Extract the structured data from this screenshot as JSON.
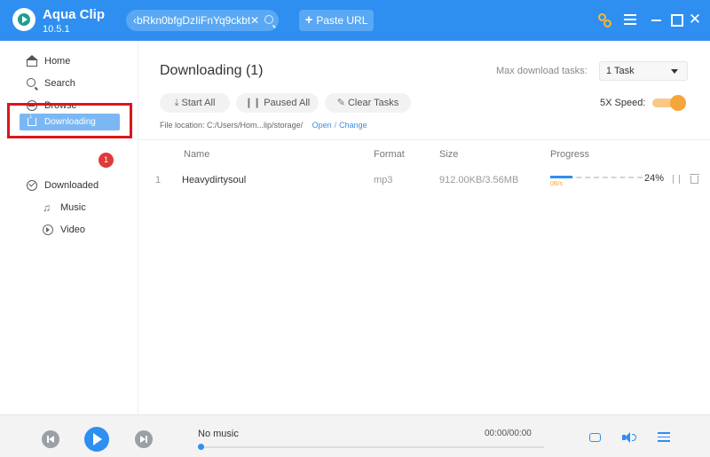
{
  "app": {
    "name": "Aqua Clip",
    "version": "10.5.1"
  },
  "topbar": {
    "url_value": "‹bRkn0bfgDzIiFnYq9ckbt",
    "url_clear": "✕",
    "paste_label": "Paste URL",
    "paste_icon": "+",
    "icons": [
      "key-icon",
      "menu-icon",
      "minimize-icon",
      "maximize-icon",
      "close-icon"
    ],
    "close_glyph": "✕"
  },
  "sidebar": {
    "items": [
      {
        "label": "Home",
        "icon": "home-icon"
      },
      {
        "label": "Search",
        "icon": "search-icon"
      },
      {
        "label": "Browse",
        "icon": "browse-icon"
      }
    ],
    "downloading": {
      "label": "Downloading",
      "badge": "1"
    },
    "downloaded": {
      "label": "Downloaded"
    },
    "sub_items": [
      {
        "label": "Music",
        "icon": "music-icon"
      },
      {
        "label": "Video",
        "icon": "video-icon"
      }
    ]
  },
  "main": {
    "title": "Downloading (1)",
    "max_tasks_label": "Max download tasks:",
    "max_tasks_value": "1 Task",
    "buttons": {
      "start_all": "Start All",
      "paused_all": "Paused All",
      "clear_tasks": "Clear Tasks"
    },
    "speed_label": "5X Speed:",
    "speed_enabled": true,
    "file_location": {
      "label": "File location:",
      "path": "C:/Users/Hom...lip/storage/",
      "open": "Open",
      "separator": "/",
      "change": "Change"
    },
    "table": {
      "headers": {
        "name": "Name",
        "format": "Format",
        "size": "Size",
        "progress": "Progress"
      },
      "rows": [
        {
          "index": "1",
          "name": "Heavydirtysoul",
          "format": "mp3",
          "size": "912.00KB/3.56MB",
          "progress_pct": "24%",
          "progress_value": 0.24,
          "speed": "0B/s"
        }
      ]
    }
  },
  "player": {
    "track": "No music",
    "time": "00:00/00:00",
    "seek_value": 0
  },
  "colors": {
    "accent": "#2e8ff0",
    "highlight_border": "#d9171c",
    "badge": "#e03a3a",
    "speed_toggle": "#f5a63a"
  }
}
